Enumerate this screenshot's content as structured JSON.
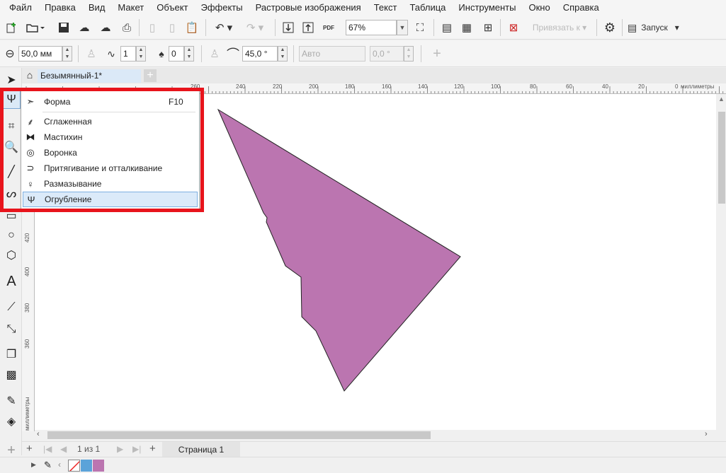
{
  "menu": [
    "Файл",
    "Правка",
    "Вид",
    "Макет",
    "Объект",
    "Эффекты",
    "Растровые изображения",
    "Текст",
    "Таблица",
    "Инструменты",
    "Окно",
    "Справка"
  ],
  "toolbar": {
    "zoom_value": "67%",
    "snap_label": "Привязать к",
    "launch_label": "Запуск",
    "pdf_label": "PDF"
  },
  "properties": {
    "nib_size": "50,0 мм",
    "frequency": "1",
    "dryout": "0",
    "tilt": "45,0 °",
    "bearing_mode": "Авто",
    "bearing": "0,0 °"
  },
  "document": {
    "tab_title": "Безымянный-1*"
  },
  "ruler": {
    "h_labels": [
      "260",
      "240",
      "220",
      "200",
      "180",
      "160",
      "140",
      "120",
      "100",
      "80",
      "60",
      "40",
      "20",
      "0"
    ],
    "h_units": "миллиметры",
    "v_labels": [
      "420",
      "400",
      "380",
      "360"
    ],
    "v_units": "миллиметры"
  },
  "flyout": {
    "items": [
      {
        "icon": "shape-tool-icon",
        "label": "Форма",
        "shortcut": "F10"
      },
      {
        "icon": "smooth-tool-icon",
        "label": "Сглаженная"
      },
      {
        "icon": "smear-tool-icon",
        "label": "Мастихин"
      },
      {
        "icon": "twirl-tool-icon",
        "label": "Воронка"
      },
      {
        "icon": "attract-repel-tool-icon",
        "label": "Притягивание и отталкивание"
      },
      {
        "icon": "smudge-tool-icon",
        "label": "Размазывание"
      },
      {
        "icon": "roughen-tool-icon",
        "label": "Огрубление"
      }
    ],
    "selected": "Огрубление"
  },
  "pages": {
    "counter": "1 из 1",
    "tab": "Страница 1"
  },
  "colors": {
    "shape_fill": "#bb75b0",
    "palette": [
      "#5ba3d9",
      "#bb75b0"
    ],
    "highlight": "#e8141c"
  }
}
